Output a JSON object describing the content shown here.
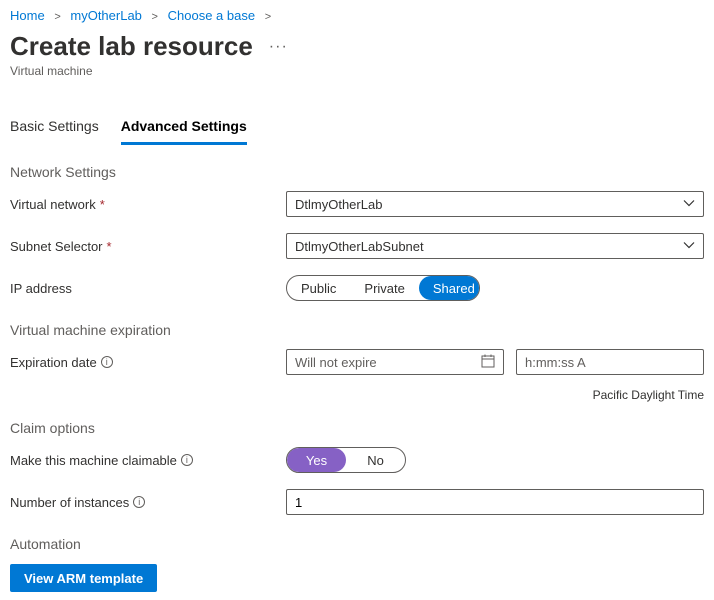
{
  "breadcrumb": {
    "items": [
      "Home",
      "myOtherLab",
      "Choose a base"
    ]
  },
  "header": {
    "title": "Create lab resource",
    "subtitle": "Virtual machine"
  },
  "tabs": {
    "basic": "Basic Settings",
    "advanced": "Advanced Settings"
  },
  "sections": {
    "network": "Network Settings",
    "expiration": "Virtual machine expiration",
    "claim": "Claim options",
    "automation": "Automation"
  },
  "labels": {
    "vnet": "Virtual network",
    "subnet": "Subnet Selector",
    "ip": "IP address",
    "expDate": "Expiration date",
    "claimable": "Make this machine claimable",
    "instances": "Number of instances"
  },
  "values": {
    "vnet": "DtlmyOtherLab",
    "subnet": "DtlmyOtherLabSubnet",
    "ipOptions": [
      "Public",
      "Private",
      "Shared"
    ],
    "ipSelected": "Shared",
    "expDatePlaceholder": "Will not expire",
    "expTimePlaceholder": "h:mm:ss A",
    "tz": "Pacific Daylight Time",
    "claimOptions": [
      "Yes",
      "No"
    ],
    "claimSelected": "Yes",
    "instances": "1"
  },
  "buttons": {
    "viewArm": "View ARM template"
  }
}
